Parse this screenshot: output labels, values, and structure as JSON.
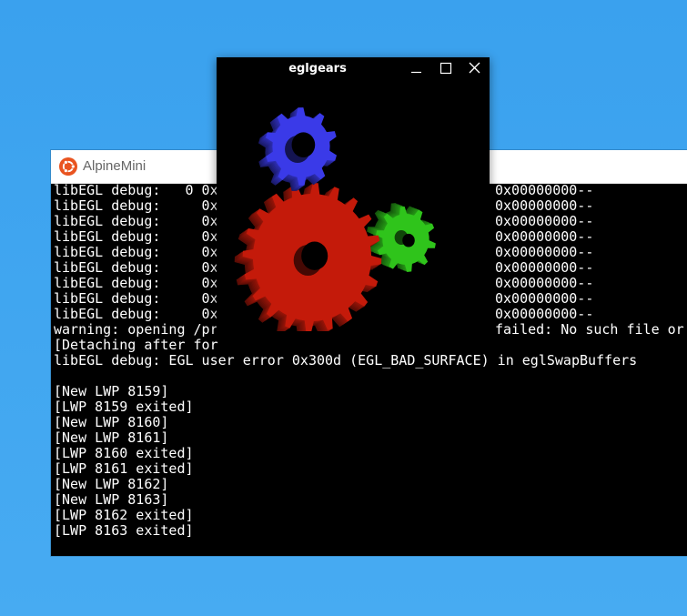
{
  "terminal": {
    "title": "AlpineMini",
    "lines": [
      {
        "left": "libEGL debug:   0 0x",
        "right": "0x00000000--"
      },
      {
        "left": "libEGL debug:     0x",
        "right": "0x00000000--"
      },
      {
        "left": "libEGL debug:     0x",
        "right": "0x00000000--"
      },
      {
        "left": "libEGL debug:     0x",
        "right": "0x00000000--"
      },
      {
        "left": "libEGL debug:     0x",
        "right": "0x00000000--"
      },
      {
        "left": "libEGL debug:     0x",
        "right": "0x00000000--"
      },
      {
        "left": "libEGL debug:     0x",
        "right": "0x00000000--"
      },
      {
        "left": "libEGL debug:     0x",
        "right": "0x00000000--"
      },
      {
        "left": "libEGL debug:     0x",
        "right": "0x00000000--"
      },
      {
        "left": "warning: opening /pr",
        "right": "failed: No such file or"
      },
      {
        "left": "[Detaching after for",
        "right": ""
      },
      {
        "left": "libEGL debug: EGL user error 0x300d (EGL_BAD_SURFACE) in eglSwapBuffers",
        "right": ""
      },
      {
        "left": "",
        "right": ""
      },
      {
        "left": "[New LWP 8159]",
        "right": ""
      },
      {
        "left": "[LWP 8159 exited]",
        "right": ""
      },
      {
        "left": "[New LWP 8160]",
        "right": ""
      },
      {
        "left": "[New LWP 8161]",
        "right": ""
      },
      {
        "left": "[LWP 8160 exited]",
        "right": ""
      },
      {
        "left": "[LWP 8161 exited]",
        "right": ""
      },
      {
        "left": "[New LWP 8162]",
        "right": ""
      },
      {
        "left": "[New LWP 8163]",
        "right": ""
      },
      {
        "left": "[LWP 8162 exited]",
        "right": ""
      },
      {
        "left": "[LWP 8163 exited]",
        "right": ""
      }
    ]
  },
  "gears_window": {
    "title": "eglgears"
  },
  "colors": {
    "desktop": "#3fa3ee",
    "gear_red": "#c41a0a",
    "gear_green": "#2fc41b",
    "gear_blue": "#3a3ae8",
    "ubuntu_orange": "#e95420"
  },
  "icons": {
    "terminal_app": "ubuntu-logo-icon",
    "minimize": "minimize-icon",
    "maximize": "maximize-icon",
    "close": "close-icon"
  }
}
